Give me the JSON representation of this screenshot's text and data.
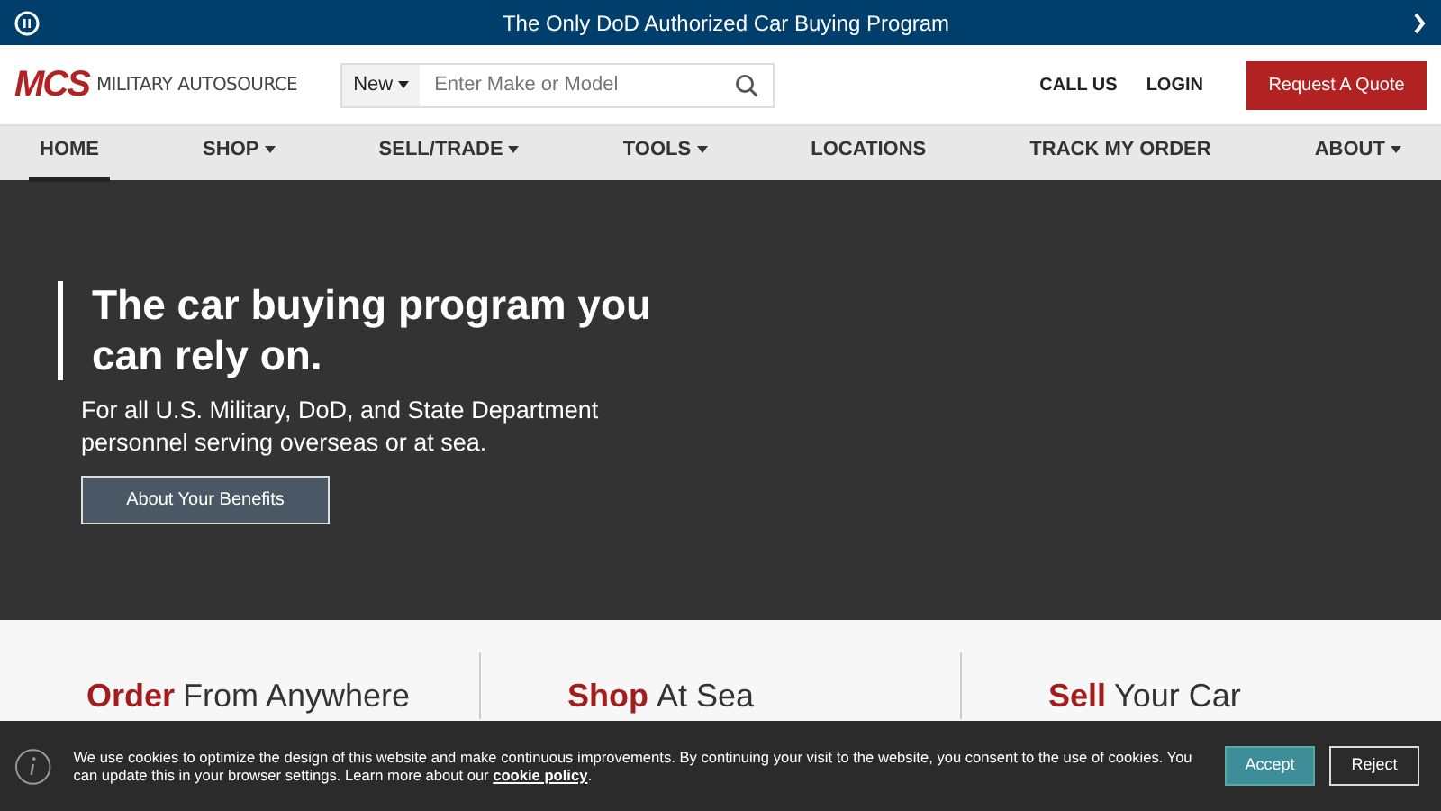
{
  "announcement": {
    "text": "The Only DoD Authorized Car Buying Program"
  },
  "header": {
    "logo": "MCS",
    "brand": "MILITARY AUTOSOURCE",
    "search_type": "New",
    "search": {
      "placeholder": "Enter Make or Model"
    },
    "links": [
      "CALL US",
      "LOGIN"
    ],
    "cta": "Request A Quote"
  },
  "nav": [
    {
      "label": "HOME",
      "selected": true,
      "dropdown": false
    },
    {
      "label": "SHOP",
      "selected": false,
      "dropdown": true
    },
    {
      "label": "SELL/TRADE",
      "selected": false,
      "dropdown": true
    },
    {
      "label": "TOOLS",
      "selected": false,
      "dropdown": true
    },
    {
      "label": "LOCATIONS",
      "selected": false,
      "dropdown": false
    },
    {
      "label": "TRACK MY ORDER",
      "selected": false,
      "dropdown": false
    },
    {
      "label": "ABOUT",
      "selected": false,
      "dropdown": true
    }
  ],
  "hero": {
    "title": "The car buying program you can rely on.",
    "subtitle": "For all U.S. Military, DoD, and State Department personnel serving overseas or at sea.",
    "button": "About Your Benefits"
  },
  "features": [
    {
      "accent": "Order",
      "rest": "From Anywhere"
    },
    {
      "accent": "Shop",
      "rest": "At Sea"
    },
    {
      "accent": "Sell",
      "rest": "Your Car"
    }
  ],
  "cookie_banner": {
    "text": "We use cookies to optimize the design of this website and make continuous improvements. By continuing your visit to the website, you consent to the use of cookies. You can update this in your browser settings.  Learn more about our",
    "link": "cookie policy",
    "end": ".",
    "buttons": [
      "Accept",
      "Reject"
    ]
  }
}
